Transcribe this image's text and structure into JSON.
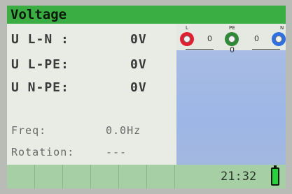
{
  "title": "Voltage",
  "measurements": [
    {
      "label": "U L-N :",
      "value": "0V"
    },
    {
      "label": "U L-PE:",
      "value": "0V"
    },
    {
      "label": "U N-PE:",
      "value": "0V"
    }
  ],
  "freq": {
    "label": "Freq:",
    "value": "0.0Hz"
  },
  "rotation": {
    "label": "Rotation:",
    "value": "---"
  },
  "terminals": {
    "L": {
      "label": "L",
      "color": "#e02030"
    },
    "PE": {
      "label": "PE",
      "color": "#2e8a36"
    },
    "N": {
      "label": "N",
      "color": "#2f6fe0"
    },
    "between_L_PE": "0",
    "between_PE_N": "0",
    "below_PE": "0"
  },
  "footer": {
    "time": "21:32",
    "battery_level": 1.0
  },
  "colors": {
    "title_bar": "#3bae43",
    "footer": "#a7cfa6",
    "right_panel": "#a8bce4"
  }
}
